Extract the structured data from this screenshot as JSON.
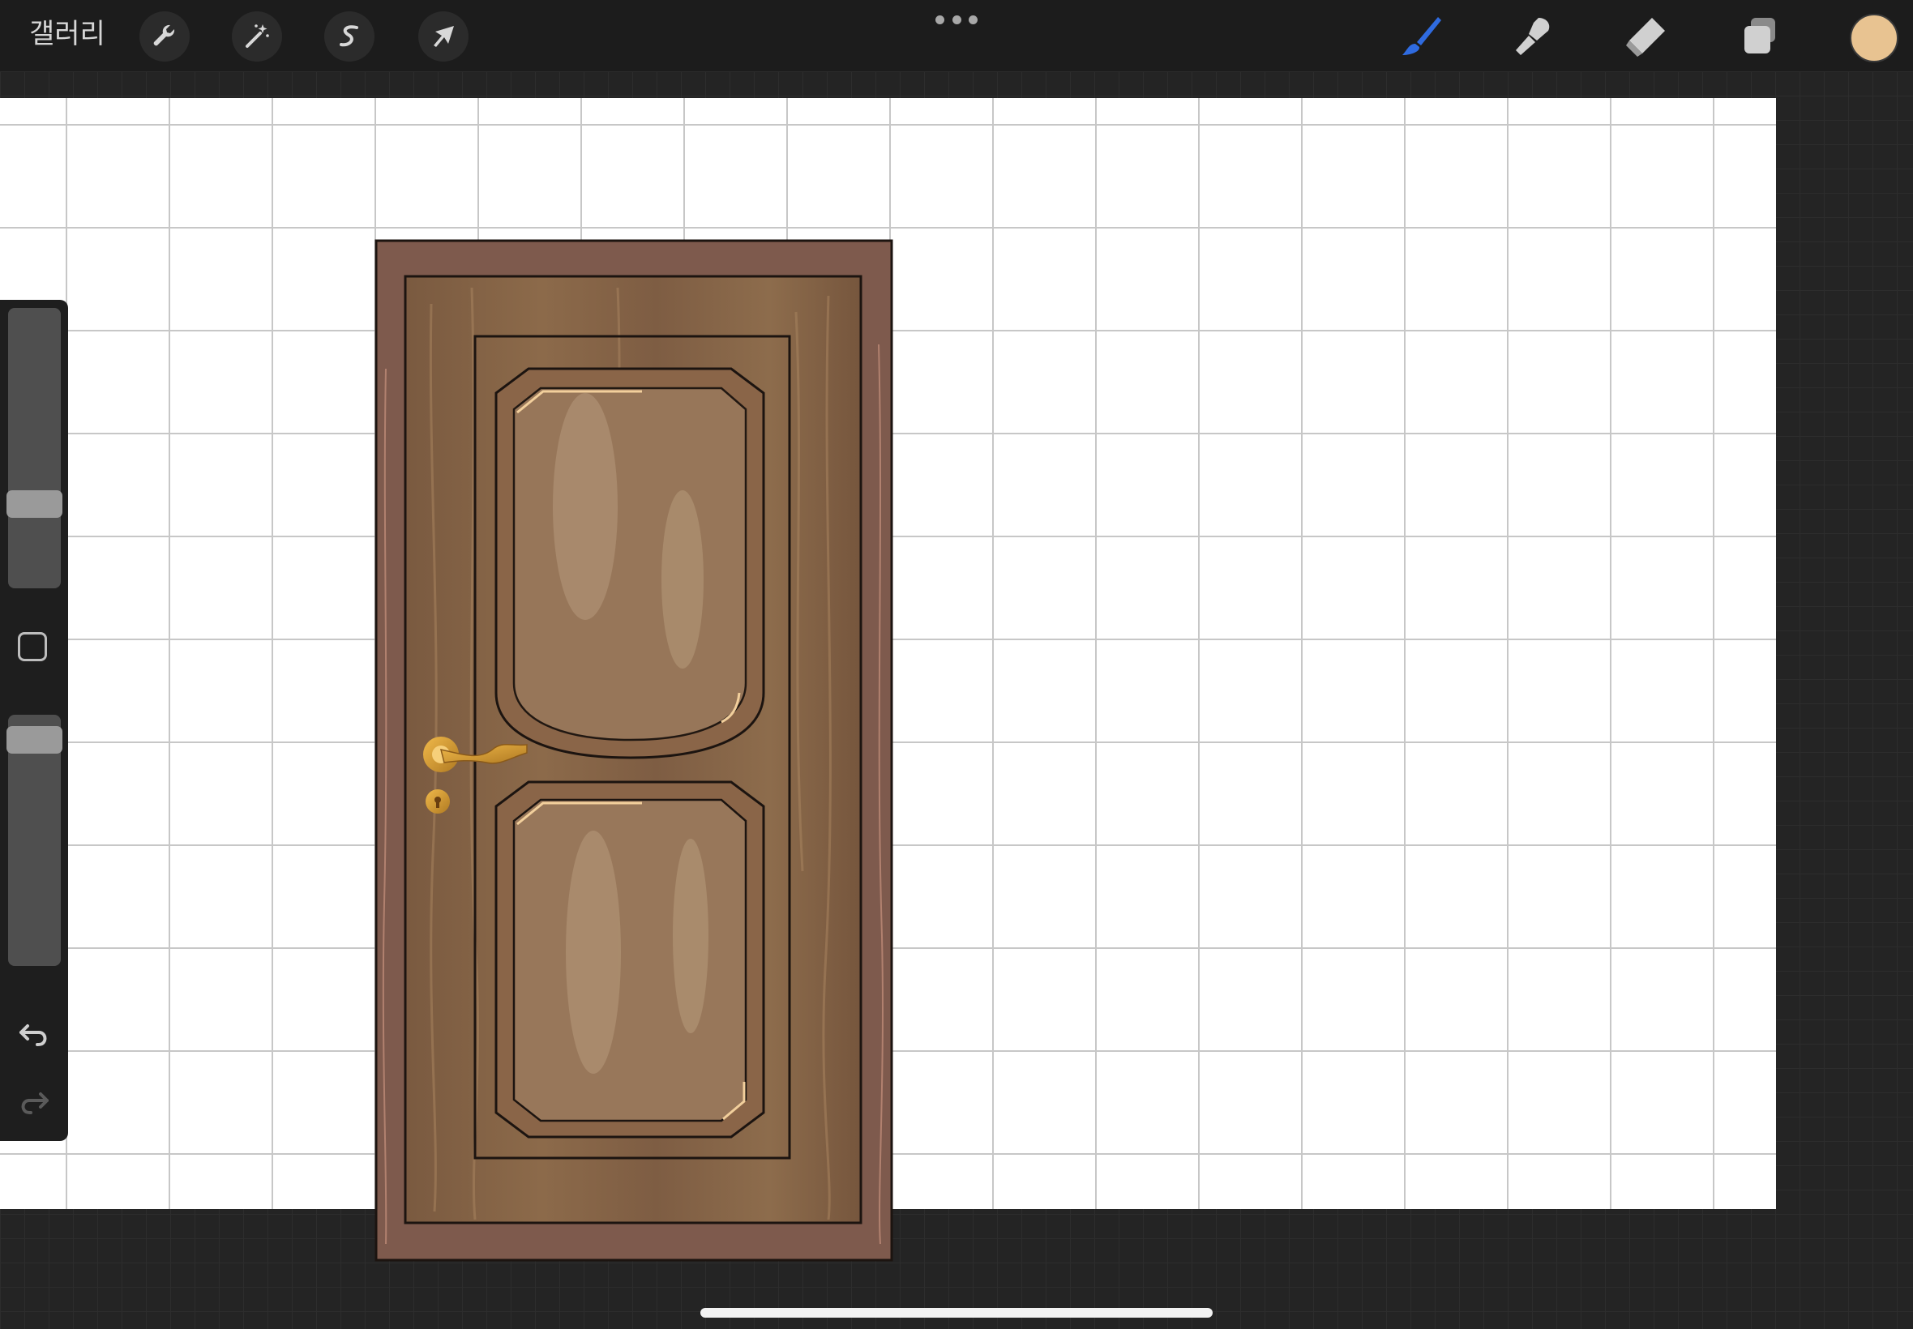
{
  "app": {
    "gallery_label": "갤러리"
  },
  "toolbar": {
    "left_tools": [
      {
        "name": "actions",
        "icon": "wrench-icon"
      },
      {
        "name": "adjustments",
        "icon": "magic-wand-icon"
      },
      {
        "name": "selection",
        "icon": "selection-s-icon"
      },
      {
        "name": "transform",
        "icon": "arrow-cursor-icon"
      }
    ],
    "more_icon": "more-dots-icon",
    "right_tools": [
      {
        "name": "brush",
        "icon": "brush-icon",
        "active": true
      },
      {
        "name": "smudge",
        "icon": "smudge-icon",
        "active": false
      },
      {
        "name": "eraser",
        "icon": "eraser-icon",
        "active": false
      },
      {
        "name": "layers",
        "icon": "layers-icon",
        "active": false
      }
    ],
    "current_color": "#E8C391",
    "active_tool_color": "#2F6BE0"
  },
  "sidebar": {
    "brush_size_level": 0.28,
    "opacity_level": 0.95,
    "modify_icon": "square-modify-icon",
    "undo_icon": "undo-icon",
    "redo_icon": "redo-icon"
  },
  "canvas": {
    "background": "#FFFFFF",
    "drawing_guide": true,
    "artwork": "wooden-door-drawing"
  }
}
